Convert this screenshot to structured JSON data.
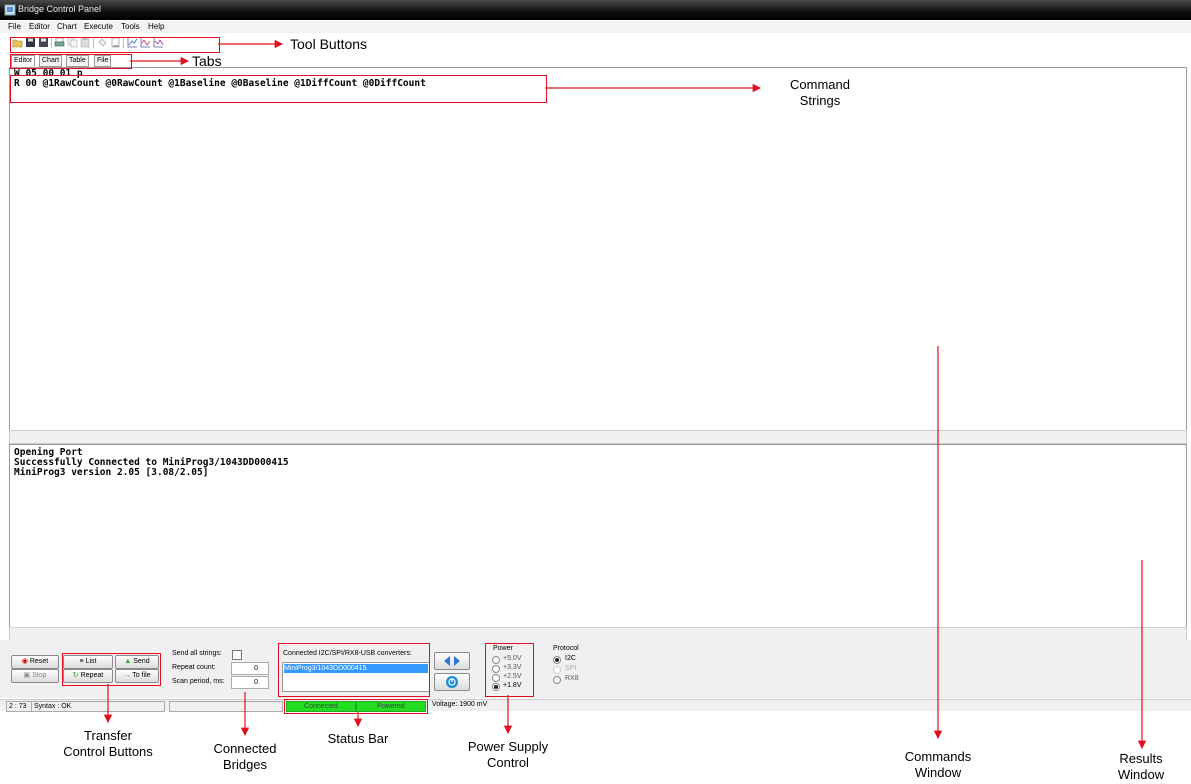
{
  "window": {
    "title": "Bridge Control Panel"
  },
  "menu": [
    "File",
    "Editor",
    "Chart",
    "Execute",
    "Tools",
    "Help"
  ],
  "toolbar_icons": [
    "open-icon",
    "save-icon",
    "save-all-icon",
    "print-icon",
    "copy-icon",
    "paste-icon",
    "find-icon",
    "page-icon",
    "chart1-icon",
    "chart2-icon",
    "chart3-icon"
  ],
  "tabs": [
    "Editor",
    "Chart",
    "Table",
    "File"
  ],
  "commands": {
    "lines": [
      "W 05 00 01 p",
      "R 00 @1RawCount @0RawCount @1Baseline @0Baseline @1DiffCount @0DiffCount"
    ]
  },
  "results": {
    "lines": [
      "Opening Port",
      "Successfully Connected to MiniProg3/1043DD000415",
      "MiniProg3 version 2.05 [3.08/2.05]"
    ]
  },
  "controls": {
    "reset": "Reset",
    "stop": "Stop",
    "list": "List",
    "send": "Send",
    "repeat": "Repeat",
    "to_file": "To file",
    "send_all_label": "Send all strings:",
    "repeat_count_label": "Repeat count:",
    "repeat_count_value": "0",
    "scan_period_label": "Scan period, ms:",
    "scan_period_value": "0"
  },
  "bridges": {
    "label": "Connected I2C/SPI/RX8-USB converters:",
    "items": [
      "MiniProg3/1043DD000415"
    ]
  },
  "power": {
    "label": "Power",
    "options": [
      "+5.0V",
      "+3.3V",
      "+2.5V",
      "+1.8V"
    ],
    "selected": "+1.8V"
  },
  "protocol": {
    "label": "Protocol",
    "options": [
      "I2C",
      "SPI",
      "RX8"
    ],
    "selected": "I2C"
  },
  "status": {
    "position": "2 : 73",
    "syntax": "Syntax : OK",
    "connected": "Connected",
    "powered": "Powered",
    "voltage": "Voltage: 1900 mV"
  },
  "annotations": {
    "tool_buttons": "Tool Buttons",
    "tabs": "Tabs",
    "command_strings_1": "Command",
    "command_strings_2": "Strings",
    "transfer_1": "Transfer",
    "transfer_2": "Control Buttons",
    "bridges_1": "Connected",
    "bridges_2": "Bridges",
    "status_bar": "Status Bar",
    "power_1": "Power Supply",
    "power_2": "Control",
    "commands_1": "Commands",
    "commands_2": "Window",
    "results_1": "Results",
    "results_2": "Window"
  },
  "colors": {
    "annotation": "#e01020",
    "status_green": "#22dd22",
    "selection": "#3399ff"
  }
}
